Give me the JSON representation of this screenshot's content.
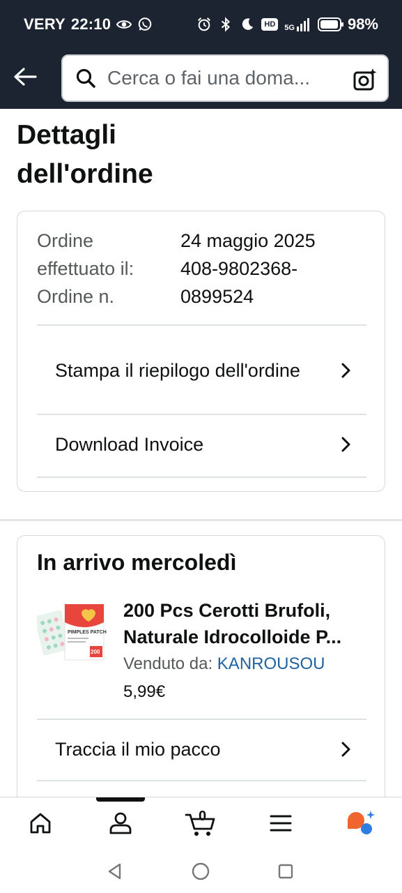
{
  "status_bar": {
    "carrier": "VERY",
    "time": "22:10",
    "network": "5G",
    "hd": "HD",
    "battery_text": "98%",
    "battery_level": 0.98
  },
  "header": {
    "search_placeholder": "Cerca o fai una doma...",
    "icons": [
      "back-arrow-icon",
      "search-icon",
      "camera-icon"
    ]
  },
  "page": {
    "title": "Dettagli dell'ordine"
  },
  "order_card": {
    "labels": [
      "Ordine",
      "effettuato il:",
      "Ordine n."
    ],
    "date": "24 maggio 2025",
    "number_line1": "408-9802368-",
    "number_line2": "0899524",
    "actions": [
      {
        "label": "Stampa il riepilogo dell'ordine"
      },
      {
        "label": "Download Invoice"
      }
    ]
  },
  "shipment_card": {
    "title": "In arrivo mercoledì",
    "product": {
      "title_line1": "200 Pcs Cerotti Brufoli,",
      "title_line2": "Naturale Idrocolloide P...",
      "seller_label": "Venduto da:",
      "seller_name": "KANROUSOU",
      "price": "5,99€",
      "thumb_brand": "PIMPLES PATCH",
      "thumb_count": "200"
    },
    "track_label": "Traccia il mio pacco"
  },
  "bottom_nav": {
    "cart_count": "0",
    "items": [
      "home-icon",
      "account-icon",
      "cart-icon",
      "menu-icon",
      "rufus-icon"
    ]
  },
  "colors": {
    "header_bg": "#1b2430",
    "link_blue": "#2162a1",
    "accent_orange": "#f0642e"
  }
}
